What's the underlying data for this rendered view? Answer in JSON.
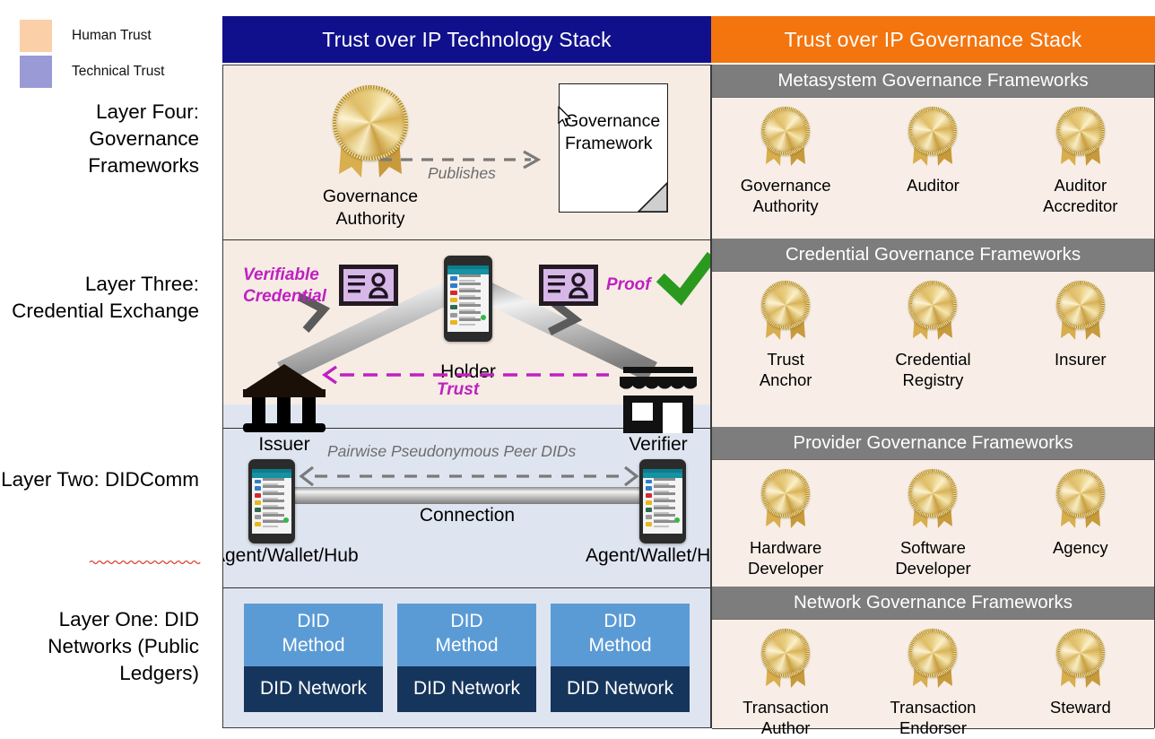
{
  "legend": {
    "items": [
      {
        "label": "Human Trust",
        "color": "#fbcfa8",
        "icon": "swatch-icon"
      },
      {
        "label": "Technical Trust",
        "color": "#9a9ad6",
        "icon": "swatch-icon"
      }
    ]
  },
  "layer_names": [
    {
      "id": "four",
      "text": "Layer Four: Governance Frameworks"
    },
    {
      "id": "three",
      "text": "Layer Three: Credential Exchange"
    },
    {
      "id": "two",
      "text": "Layer Two: DIDComm"
    },
    {
      "id": "one",
      "text": "Layer One: DID Networks (Public Ledgers)"
    }
  ],
  "headers": {
    "technology": "Trust over IP Technology Stack",
    "governance": "Trust over IP Governance Stack",
    "technology_color": "#10108c",
    "governance_color": "#f4740d"
  },
  "technology": {
    "layer_four": {
      "authority_caption": "Governance\nAuthority",
      "arrow_label": "Publishes",
      "document_text": "Governance\nFramework"
    },
    "layer_three": {
      "credential_label": "Verifiable\nCredential",
      "proof_label": "Proof",
      "trust_label": "Trust",
      "issuer_caption": "Issuer",
      "holder_caption": "Holder",
      "verifier_caption": "Verifier",
      "check_color": "#2a9a1e"
    },
    "layer_two": {
      "dids_label": "Pairwise Pseudonymous Peer DIDs",
      "connection_label": "Connection",
      "left_caption": "Agent/Wallet/Hub",
      "right_caption": "Agent/Wallet/Hub"
    },
    "layer_one": {
      "blocks": [
        {
          "method": "DID\nMethod",
          "network": "DID Network"
        },
        {
          "method": "DID\nMethod",
          "network": "DID Network"
        },
        {
          "method": "DID\nMethod",
          "network": "DID Network"
        }
      ],
      "method_color": "#5b9bd5",
      "network_color": "#16355c"
    }
  },
  "governance": {
    "blocks": [
      {
        "id": "metasystem",
        "title": "Metasystem Governance Frameworks",
        "items": [
          "Governance\nAuthority",
          "Auditor",
          "Auditor\nAccreditor"
        ]
      },
      {
        "id": "credential",
        "title": "Credential Governance Frameworks",
        "items": [
          "Trust\nAnchor",
          "Credential\nRegistry",
          "Insurer"
        ]
      },
      {
        "id": "provider",
        "title": "Provider Governance Frameworks",
        "items": [
          "Hardware\nDeveloper",
          "Software\nDeveloper",
          "Agency"
        ]
      },
      {
        "id": "network",
        "title": "Network Governance Frameworks",
        "items": [
          "Transaction\nAuthor",
          "Transaction\nEndorser",
          "Steward"
        ]
      }
    ],
    "header_color": "#7d7d7d",
    "body_color": "#f8eee7"
  },
  "bands": {
    "human_trust_color": "#f6ece4",
    "technical_trust_color": "#dfe5f0"
  }
}
